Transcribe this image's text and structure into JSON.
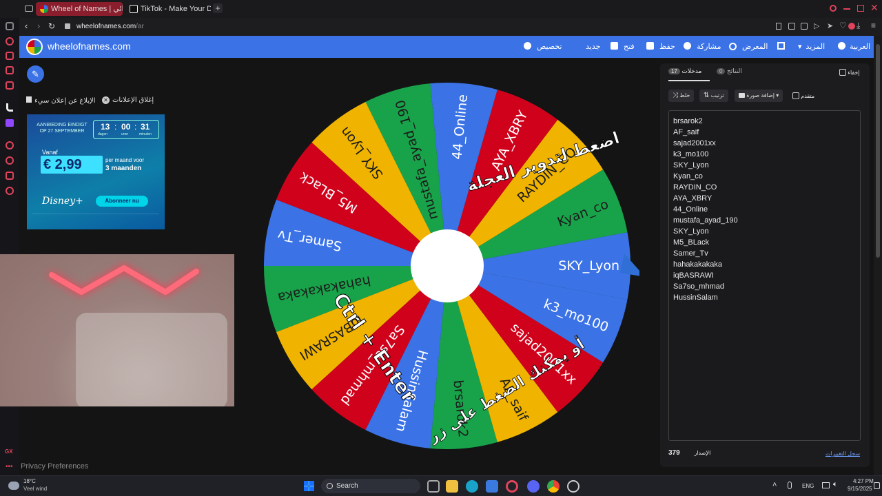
{
  "browser": {
    "tabs": [
      {
        "label": "Wheel of Names | عشوائي"
      },
      {
        "label": "TikTok - Make Your Day"
      }
    ],
    "url_host": "wheelofnames.com",
    "url_path": "/ar"
  },
  "site": {
    "logo_text": "wheelofnames.com",
    "nav": {
      "customize": "تخصيص",
      "new": "جديد",
      "open": "فتح",
      "save": "حفظ",
      "share": "مشاركة",
      "gallery": "المعرض",
      "more": "المزيد",
      "language": "العربية"
    }
  },
  "ads": {
    "close_ads": "إغلاق الإعلانات",
    "report_ad": "الإبلاغ عن إعلان سيء",
    "banner": {
      "top_line": "AANBIEDING EINDIGT OP 27 SEPTEMBER",
      "countdown": [
        "13",
        "00",
        "31"
      ],
      "countdown_units": [
        "dagen",
        "uren",
        "minuten"
      ],
      "from": "Vanaf",
      "price": "€ 2,99",
      "price_note_1": "per maand voor",
      "price_note_2": "3 maanden",
      "brand": "Disney+",
      "cta": "Abonneer nu"
    }
  },
  "wheel": {
    "center_text_1": "اضغط لتدوير العجلة",
    "center_text_2": "أو يمكنك الضغط على زر",
    "shortcut": "Ctrl + Enter",
    "segment_colors": [
      "#3b73e6",
      "#18a34a",
      "#f0b400",
      "#d0021b"
    ],
    "segments": [
      "SKY_Lyon",
      "Kyan_co",
      "RAYDIN_CO",
      "AYA_XBRY",
      "44_Online",
      "mustafa_ayad_190",
      "SKY_Lyon",
      "M5_BLack",
      "Samer_Tv",
      "hahakakakaka",
      "iqBASRAWI",
      "Sa7so_mhmad",
      "HussinSalam",
      "brsarok2",
      "AF_saif",
      "sajad2001xx",
      "k3_mo100"
    ]
  },
  "panel": {
    "hide_label": "إخفاء",
    "tab_entries_label": "مدخلات",
    "tab_entries_count": "17",
    "tab_results_label": "النتائج",
    "tab_results_count": "0",
    "shuffle": "خلط",
    "sort": "ترتيب",
    "add_image": "إضافة صورة",
    "advanced": "متقدم",
    "entries": [
      "brsarok2",
      "AF_saif",
      " sajad2001xx",
      "k3_mo100",
      "SKY_Lyon",
      "Kyan_co",
      "RAYDIN_CO",
      "AYA_XBRY",
      "44_Online",
      "mustafa_ayad_190",
      "SKY_Lyon",
      "M5_BLack",
      "Samer_Tv",
      "hahakakakaka",
      "iqBASRAWI",
      "Sa7so_mhmad",
      "HussinSalam"
    ],
    "version_label": "الإصدار",
    "version": "379",
    "changelog": "سجل التغييرات"
  },
  "footer": {
    "privacy": "Privacy Preferences"
  },
  "taskbar": {
    "weather_temp": "18°C",
    "weather_desc": "Veel wind",
    "search": "Search",
    "lang": "ENG",
    "time": "4:27 PM",
    "date": "9/15/2025"
  }
}
